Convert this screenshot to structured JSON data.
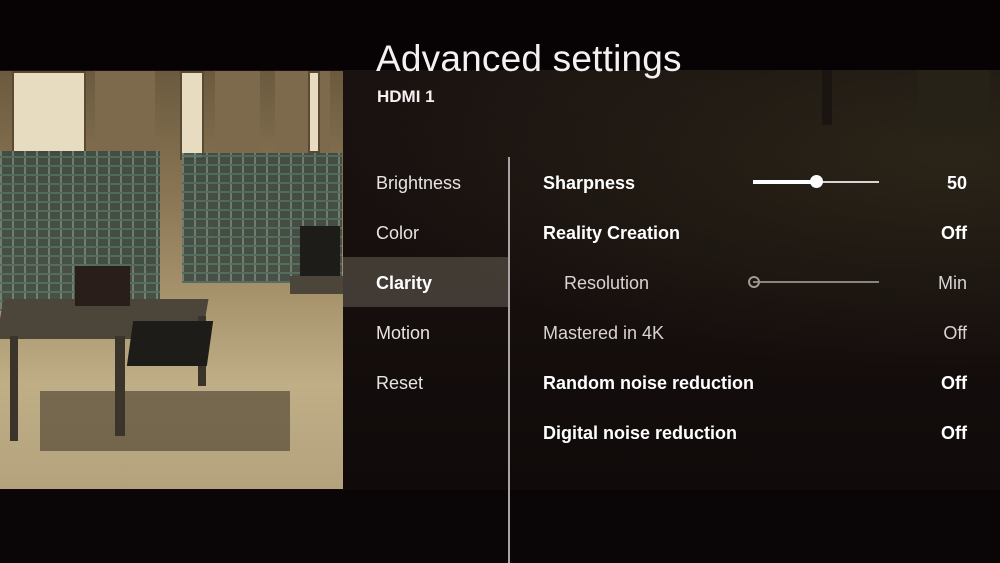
{
  "header": {
    "title": "Advanced settings",
    "subtitle": "HDMI 1"
  },
  "menu": {
    "selected_index": 2,
    "items": [
      {
        "label": "Brightness"
      },
      {
        "label": "Color"
      },
      {
        "label": "Clarity"
      },
      {
        "label": "Motion"
      },
      {
        "label": "Reset"
      }
    ]
  },
  "settings": {
    "rows": [
      {
        "label": "Sharpness",
        "value": "50",
        "style": "bold",
        "control": "slider",
        "slider_fraction": 0.5
      },
      {
        "label": "Reality Creation",
        "value": "Off",
        "style": "bold"
      },
      {
        "label": "Resolution",
        "value": "Min",
        "style": "indent-disabled",
        "control": "slider-disabled",
        "slider_fraction": 0.0
      },
      {
        "label": "Mastered in 4K",
        "value": "Off",
        "style": "dim"
      },
      {
        "label": "Random noise reduction",
        "value": "Off",
        "style": "bold"
      },
      {
        "label": "Digital noise reduction",
        "value": "Off",
        "style": "bold"
      }
    ]
  },
  "colors": {
    "background": "#0b0607",
    "text": "#f4f0f0",
    "divider": "#a8a4a4",
    "selected_highlight": "#5a544c"
  }
}
